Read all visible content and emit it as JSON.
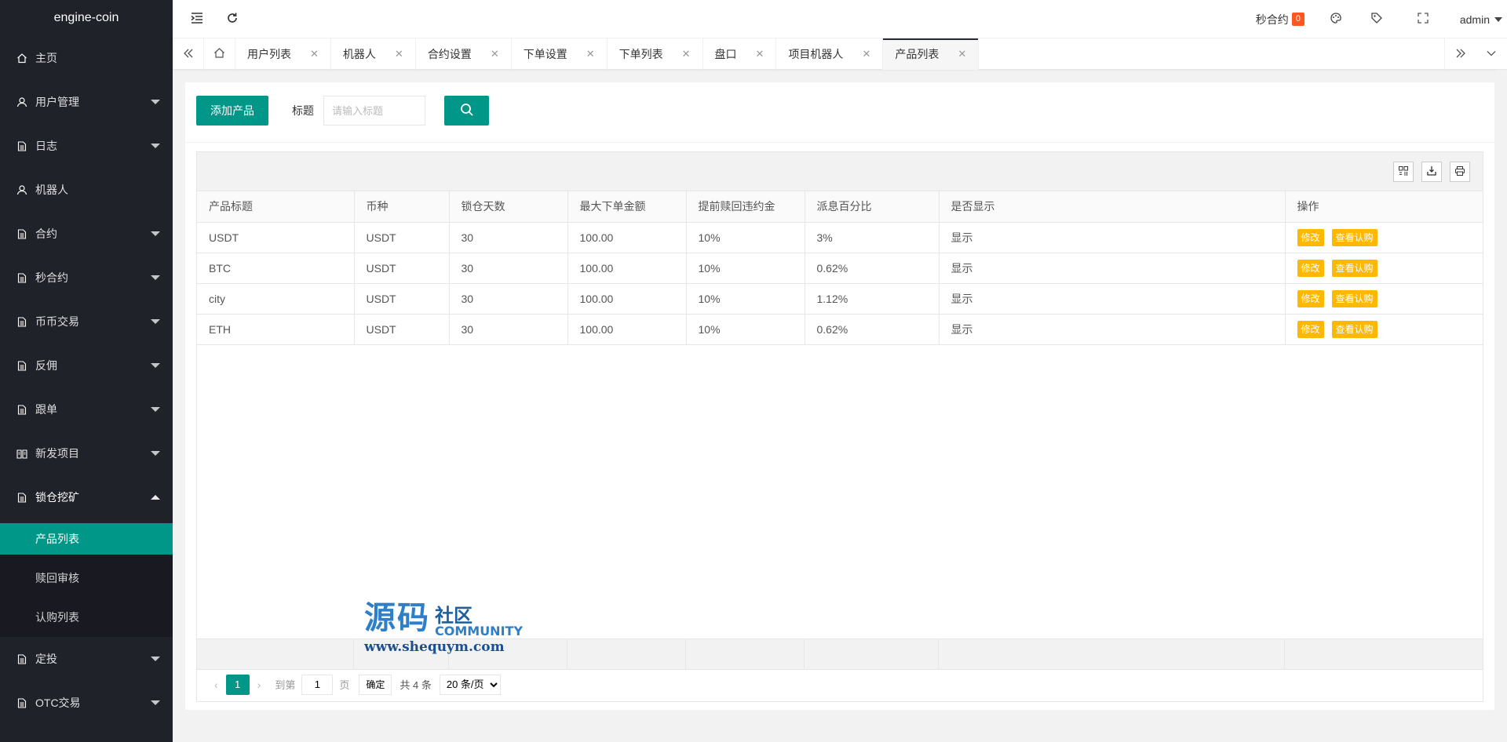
{
  "app": {
    "title": "engine-coin"
  },
  "sidebar": {
    "items": [
      {
        "label": "主页",
        "icon": "home-icon",
        "expandable": false
      },
      {
        "label": "用户管理",
        "icon": "user-icon",
        "expandable": true
      },
      {
        "label": "日志",
        "icon": "doc-icon",
        "expandable": true
      },
      {
        "label": "机器人",
        "icon": "user-icon",
        "expandable": false
      },
      {
        "label": "合约",
        "icon": "doc-icon",
        "expandable": true
      },
      {
        "label": "秒合约",
        "icon": "doc-icon",
        "expandable": true
      },
      {
        "label": "币币交易",
        "icon": "doc-icon",
        "expandable": true
      },
      {
        "label": "反佣",
        "icon": "doc-icon",
        "expandable": true
      },
      {
        "label": "跟单",
        "icon": "doc-icon",
        "expandable": true
      },
      {
        "label": "新发项目",
        "icon": "book-icon",
        "expandable": true
      },
      {
        "label": "锁仓挖矿",
        "icon": "doc-icon",
        "expandable": true,
        "open": true
      }
    ],
    "sub_items": [
      {
        "label": "产品列表",
        "active": true
      },
      {
        "label": "赎回审核"
      },
      {
        "label": "认购列表"
      }
    ],
    "items_after": [
      {
        "label": "定投",
        "icon": "doc-icon",
        "expandable": true
      },
      {
        "label": "OTC交易",
        "icon": "doc-icon",
        "expandable": true
      }
    ]
  },
  "header": {
    "second_contract_label": "秒合约",
    "second_contract_badge": "0",
    "user": "admin"
  },
  "tabs": [
    {
      "label": "用户列表"
    },
    {
      "label": "机器人"
    },
    {
      "label": "合约设置"
    },
    {
      "label": "下单设置"
    },
    {
      "label": "下单列表"
    },
    {
      "label": "盘口"
    },
    {
      "label": "项目机器人"
    },
    {
      "label": "产品列表",
      "active": true
    }
  ],
  "toolbar": {
    "add_label": "添加产品",
    "search_label": "标题",
    "search_placeholder": "请输入标题"
  },
  "table": {
    "columns": [
      "产品标题",
      "币种",
      "锁仓天数",
      "最大下单金额",
      "提前赎回违约金",
      "派息百分比",
      "是否显示",
      "操作"
    ],
    "rows": [
      [
        "USDT",
        "USDT",
        "30",
        "100.00",
        "10%",
        "3%",
        "显示"
      ],
      [
        "BTC",
        "USDT",
        "30",
        "100.00",
        "10%",
        "0.62%",
        "显示"
      ],
      [
        "city",
        "USDT",
        "30",
        "100.00",
        "10%",
        "1.12%",
        "显示"
      ],
      [
        "ETH",
        "USDT",
        "30",
        "100.00",
        "10%",
        "0.62%",
        "显示"
      ]
    ],
    "edit_label": "修改",
    "view_label": "查看认购"
  },
  "pager": {
    "current_page": "1",
    "goto_label": "到第",
    "goto_value": "1",
    "page_unit": "页",
    "confirm_label": "确定",
    "total_label": "共 4 条",
    "page_size_label": "20 条/页"
  },
  "watermark": {
    "cn": "源码",
    "cn2": "社区",
    "en": "COMMUNITY",
    "url": "www.shequym.com"
  },
  "colors": {
    "primary": "#009688",
    "sidebar_bg": "#20222a",
    "action": "#ffb800",
    "badge": "#ff5722"
  }
}
